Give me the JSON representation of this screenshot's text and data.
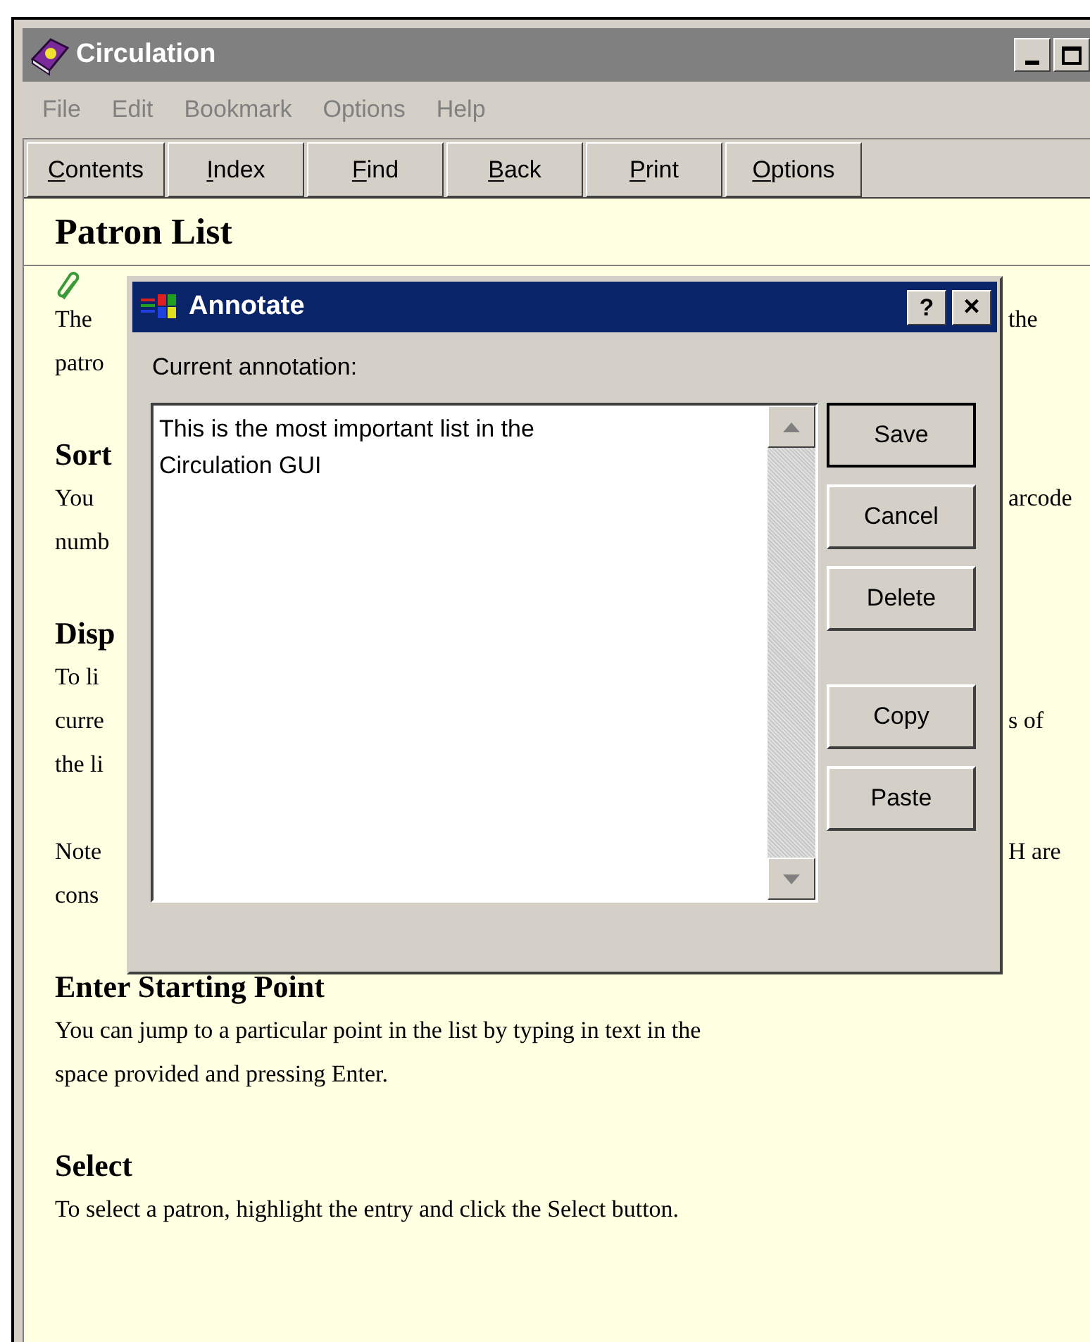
{
  "window": {
    "title": "Circulation"
  },
  "menu": [
    {
      "label": "File",
      "disabled": true
    },
    {
      "label": "Edit",
      "disabled": true
    },
    {
      "label": "Bookmark",
      "disabled": true
    },
    {
      "label": "Options",
      "disabled": true
    },
    {
      "label": "Help",
      "disabled": true
    }
  ],
  "toolbar": [
    "Contents",
    "Index",
    "Find",
    "Back",
    "Print",
    "Options"
  ],
  "page": {
    "title": "Patron List",
    "lines": [
      {
        "kind": "text",
        "left": "The",
        "right": "the"
      },
      {
        "kind": "text",
        "left": "patro"
      },
      {
        "kind": "blank"
      },
      {
        "kind": "heading",
        "left": "Sort"
      },
      {
        "kind": "text",
        "left": "You",
        "right": "arcode"
      },
      {
        "kind": "text",
        "left": "numb"
      },
      {
        "kind": "blank"
      },
      {
        "kind": "heading",
        "left": "Disp"
      },
      {
        "kind": "text",
        "left": "To li"
      },
      {
        "kind": "text",
        "left": "curre",
        "right": "s of"
      },
      {
        "kind": "text",
        "left": "the li"
      },
      {
        "kind": "blank"
      },
      {
        "kind": "text",
        "left": "Note",
        "right": "H are"
      },
      {
        "kind": "text",
        "left": "cons"
      },
      {
        "kind": "blank"
      },
      {
        "kind": "heading",
        "left": "Enter Starting Point"
      },
      {
        "kind": "text",
        "left": "You can jump to a particular point in the list by typing in text in the"
      },
      {
        "kind": "text",
        "left": "space provided and pressing Enter."
      },
      {
        "kind": "blank"
      },
      {
        "kind": "heading",
        "left": "Select"
      },
      {
        "kind": "text",
        "left": "To select a patron, highlight the entry and click the Select button."
      }
    ]
  },
  "dialog": {
    "title": "Annotate",
    "help_button": "?",
    "close_button": "×",
    "label": "Current annotation:",
    "value": "This is the most important list in the\nCirculation GUI",
    "button_groups": [
      [
        {
          "label": "Save",
          "default": true
        },
        {
          "label": "Cancel",
          "default": false
        },
        {
          "label": "Delete",
          "default": false
        }
      ],
      [
        {
          "label": "Copy",
          "default": false
        },
        {
          "label": "Paste",
          "default": false
        }
      ]
    ]
  }
}
